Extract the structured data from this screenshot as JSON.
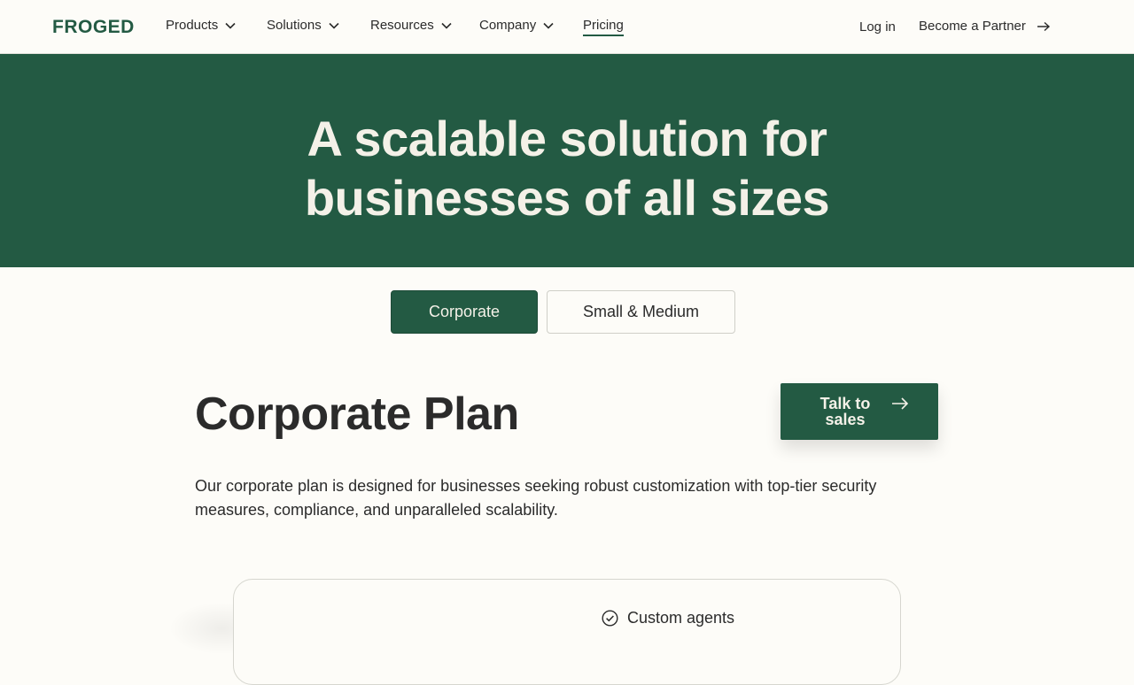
{
  "nav": {
    "logo": "FROGED",
    "items": [
      {
        "label": "Products"
      },
      {
        "label": "Solutions"
      },
      {
        "label": "Resources"
      },
      {
        "label": "Company"
      },
      {
        "label": "Pricing"
      }
    ],
    "login": "Log in",
    "partner": "Become a Partner"
  },
  "hero": {
    "title_line1": "A scalable solution for",
    "title_line2": "businesses of all sizes"
  },
  "tabs": {
    "corporate": "Corporate",
    "small_medium": "Small & Medium",
    "selected": "Corporate"
  },
  "plan": {
    "title": "Corporate Plan",
    "cta": "Talk to sales",
    "description": "Our corporate plan is designed for businesses seeking robust customization with top-tier security measures, compliance, and unparalleled scalability."
  },
  "features": [
    {
      "label": "Custom agents",
      "icon": "check-circle-icon"
    }
  ],
  "colors": {
    "brand_green": "#235a43",
    "hero_text": "#f4f1e8",
    "page_bg": "#fdfcf8"
  }
}
